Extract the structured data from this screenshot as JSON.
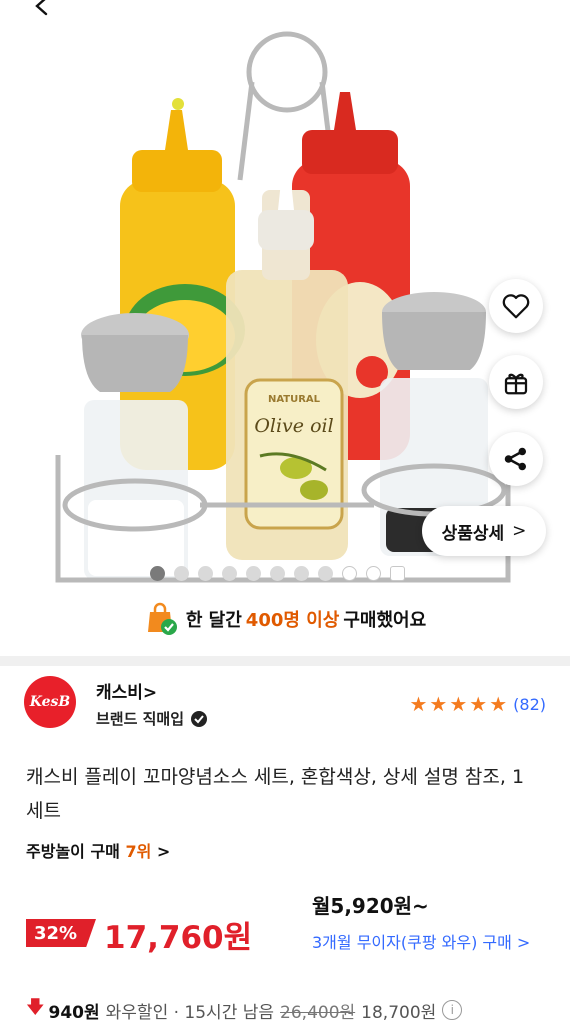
{
  "gallery": {
    "page_indicator": {
      "total": 10,
      "active_index": 0
    },
    "detail_button_label": "상품상세",
    "detail_button_chevron": ">",
    "product_label_olive": "Olive oil",
    "product_label_natural": "NATURAL"
  },
  "purchase_banner": {
    "prefix": "한 달간 ",
    "highlight": "400명 이상",
    "suffix": " 구매했어요"
  },
  "seller": {
    "logo_text": "KesB",
    "name": "캐스비>",
    "tag": "브랜드 직매입",
    "rating_stars": 5,
    "review_count": "(82)"
  },
  "product": {
    "title": "캐스비 플레이 꼬마양념소스 세트, 혼합색상, 상세 설명 참조, 1세트",
    "rank_prefix": "주방놀이 구매 ",
    "rank_value": "7위",
    "rank_chevron": ">"
  },
  "price": {
    "discount": "32%",
    "sale_price": "17,760원",
    "monthly": "월5,920원~",
    "installment": "3개월 무이자(쿠팡 와우) 구매 >"
  },
  "coupon": {
    "amount": "940원",
    "label": "와우할인 · 15시간 남음",
    "original_price": "26,400원",
    "final_price": "18,700원",
    "info_icon": "i"
  },
  "colors": {
    "accent_orange": "#e05a00",
    "sale_red": "#e0202a",
    "link_blue": "#346aff",
    "star_orange": "#f47b1f"
  }
}
